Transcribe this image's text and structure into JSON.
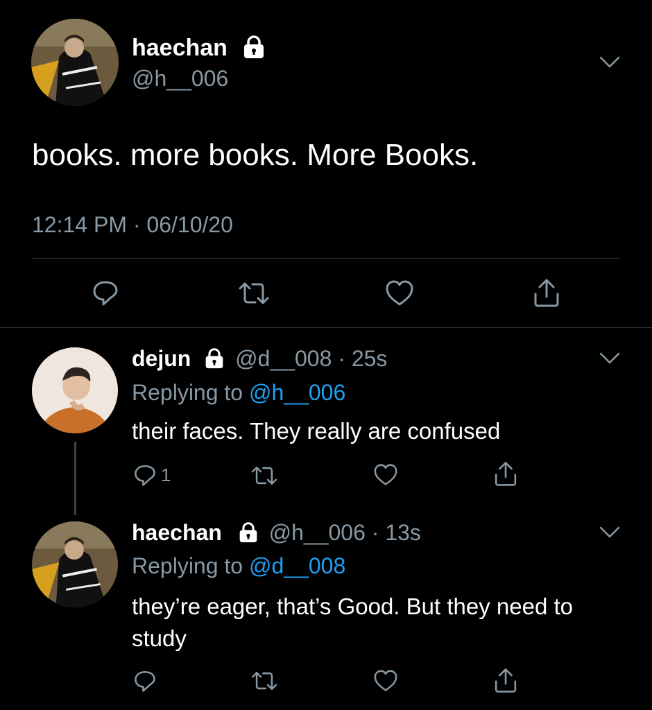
{
  "main_tweet": {
    "display_name": "haechan",
    "handle": "@h__006",
    "text": "books. more books. More Books.",
    "timestamp": "12:14 PM · 06/10/20",
    "protected": true,
    "menu_icon": "chevron-down-icon",
    "actions": [
      "reply-icon",
      "retweet-icon",
      "like-icon",
      "share-icon"
    ]
  },
  "replies": [
    {
      "display_name": "dejun",
      "handle": "@d__008",
      "time": "· 25s",
      "replying_label": "Replying to",
      "replying_to": "@h__006",
      "text": "their faces. They really are confused",
      "reply_count": "1",
      "protected": true
    },
    {
      "display_name": "haechan",
      "handle": "@h__006",
      "time": "· 13s",
      "replying_label": "Replying to",
      "replying_to": "@d__008",
      "text": "they’re eager, that’s Good. But they need to study",
      "reply_count": "",
      "protected": true
    }
  ],
  "colors": {
    "background": "#000000",
    "text": "#ffffff",
    "secondary": "#8899a6",
    "link": "#1da1f2",
    "divider": "#2f3336"
  }
}
